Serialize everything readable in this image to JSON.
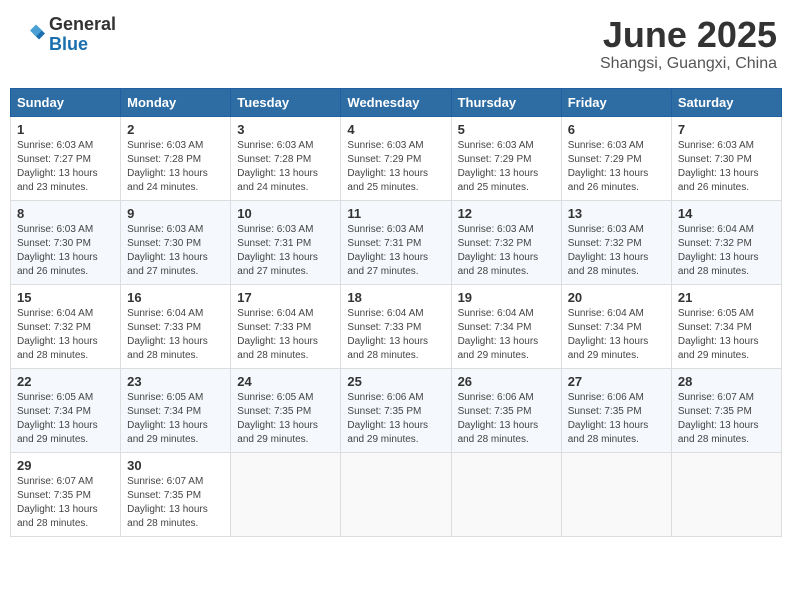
{
  "header": {
    "logo_general": "General",
    "logo_blue": "Blue",
    "month_title": "June 2025",
    "location": "Shangsi, Guangxi, China"
  },
  "weekdays": [
    "Sunday",
    "Monday",
    "Tuesday",
    "Wednesday",
    "Thursday",
    "Friday",
    "Saturday"
  ],
  "weeks": [
    [
      {
        "day": "1",
        "sunrise": "6:03 AM",
        "sunset": "7:27 PM",
        "daylight": "13 hours and 23 minutes."
      },
      {
        "day": "2",
        "sunrise": "6:03 AM",
        "sunset": "7:28 PM",
        "daylight": "13 hours and 24 minutes."
      },
      {
        "day": "3",
        "sunrise": "6:03 AM",
        "sunset": "7:28 PM",
        "daylight": "13 hours and 24 minutes."
      },
      {
        "day": "4",
        "sunrise": "6:03 AM",
        "sunset": "7:29 PM",
        "daylight": "13 hours and 25 minutes."
      },
      {
        "day": "5",
        "sunrise": "6:03 AM",
        "sunset": "7:29 PM",
        "daylight": "13 hours and 25 minutes."
      },
      {
        "day": "6",
        "sunrise": "6:03 AM",
        "sunset": "7:29 PM",
        "daylight": "13 hours and 26 minutes."
      },
      {
        "day": "7",
        "sunrise": "6:03 AM",
        "sunset": "7:30 PM",
        "daylight": "13 hours and 26 minutes."
      }
    ],
    [
      {
        "day": "8",
        "sunrise": "6:03 AM",
        "sunset": "7:30 PM",
        "daylight": "13 hours and 26 minutes."
      },
      {
        "day": "9",
        "sunrise": "6:03 AM",
        "sunset": "7:30 PM",
        "daylight": "13 hours and 27 minutes."
      },
      {
        "day": "10",
        "sunrise": "6:03 AM",
        "sunset": "7:31 PM",
        "daylight": "13 hours and 27 minutes."
      },
      {
        "day": "11",
        "sunrise": "6:03 AM",
        "sunset": "7:31 PM",
        "daylight": "13 hours and 27 minutes."
      },
      {
        "day": "12",
        "sunrise": "6:03 AM",
        "sunset": "7:32 PM",
        "daylight": "13 hours and 28 minutes."
      },
      {
        "day": "13",
        "sunrise": "6:03 AM",
        "sunset": "7:32 PM",
        "daylight": "13 hours and 28 minutes."
      },
      {
        "day": "14",
        "sunrise": "6:04 AM",
        "sunset": "7:32 PM",
        "daylight": "13 hours and 28 minutes."
      }
    ],
    [
      {
        "day": "15",
        "sunrise": "6:04 AM",
        "sunset": "7:32 PM",
        "daylight": "13 hours and 28 minutes."
      },
      {
        "day": "16",
        "sunrise": "6:04 AM",
        "sunset": "7:33 PM",
        "daylight": "13 hours and 28 minutes."
      },
      {
        "day": "17",
        "sunrise": "6:04 AM",
        "sunset": "7:33 PM",
        "daylight": "13 hours and 28 minutes."
      },
      {
        "day": "18",
        "sunrise": "6:04 AM",
        "sunset": "7:33 PM",
        "daylight": "13 hours and 28 minutes."
      },
      {
        "day": "19",
        "sunrise": "6:04 AM",
        "sunset": "7:34 PM",
        "daylight": "13 hours and 29 minutes."
      },
      {
        "day": "20",
        "sunrise": "6:04 AM",
        "sunset": "7:34 PM",
        "daylight": "13 hours and 29 minutes."
      },
      {
        "day": "21",
        "sunrise": "6:05 AM",
        "sunset": "7:34 PM",
        "daylight": "13 hours and 29 minutes."
      }
    ],
    [
      {
        "day": "22",
        "sunrise": "6:05 AM",
        "sunset": "7:34 PM",
        "daylight": "13 hours and 29 minutes."
      },
      {
        "day": "23",
        "sunrise": "6:05 AM",
        "sunset": "7:34 PM",
        "daylight": "13 hours and 29 minutes."
      },
      {
        "day": "24",
        "sunrise": "6:05 AM",
        "sunset": "7:35 PM",
        "daylight": "13 hours and 29 minutes."
      },
      {
        "day": "25",
        "sunrise": "6:06 AM",
        "sunset": "7:35 PM",
        "daylight": "13 hours and 29 minutes."
      },
      {
        "day": "26",
        "sunrise": "6:06 AM",
        "sunset": "7:35 PM",
        "daylight": "13 hours and 28 minutes."
      },
      {
        "day": "27",
        "sunrise": "6:06 AM",
        "sunset": "7:35 PM",
        "daylight": "13 hours and 28 minutes."
      },
      {
        "day": "28",
        "sunrise": "6:07 AM",
        "sunset": "7:35 PM",
        "daylight": "13 hours and 28 minutes."
      }
    ],
    [
      {
        "day": "29",
        "sunrise": "6:07 AM",
        "sunset": "7:35 PM",
        "daylight": "13 hours and 28 minutes."
      },
      {
        "day": "30",
        "sunrise": "6:07 AM",
        "sunset": "7:35 PM",
        "daylight": "13 hours and 28 minutes."
      },
      null,
      null,
      null,
      null,
      null
    ]
  ]
}
